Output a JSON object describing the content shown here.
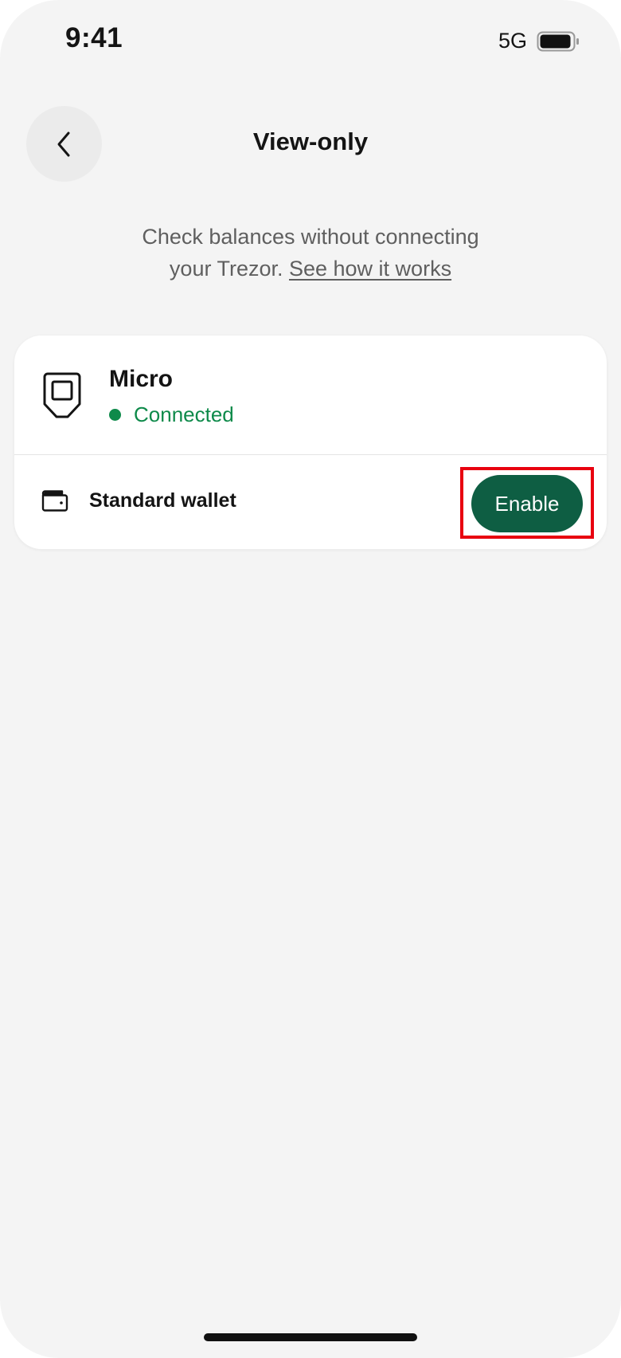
{
  "status_bar": {
    "time": "9:41",
    "network": "5G",
    "battery_icon": "battery-icon"
  },
  "header": {
    "back_icon": "chevron-left-icon",
    "title": "View-only"
  },
  "intro": {
    "text_line1": "Check balances without connecting",
    "text_line2_prefix": "your Trezor. ",
    "link_label": "See how it works"
  },
  "device": {
    "icon": "trezor-device-icon",
    "name": "Micro",
    "status": "Connected",
    "status_color": "#0e8a4a"
  },
  "wallet": {
    "icon": "wallet-icon",
    "label": "Standard wallet",
    "action_label": "Enable",
    "action_color": "#0e5e43"
  },
  "highlight_color": "#e8000f"
}
